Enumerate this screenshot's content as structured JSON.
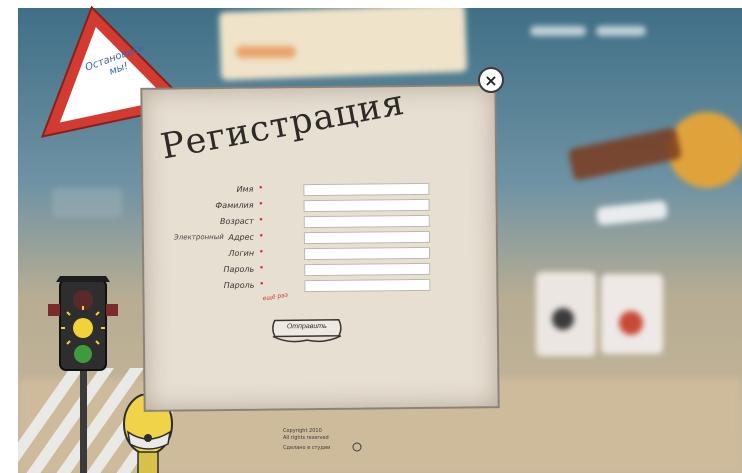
{
  "window": {
    "title": "Регистрация"
  },
  "sign": {
    "text": "Остановись мы!",
    "icon": "warning-triangle-icon"
  },
  "dialog": {
    "title": "Регистрация",
    "close_label": "×",
    "fields": [
      {
        "label": "Имя",
        "required_mark": "•",
        "value": ""
      },
      {
        "label": "Фамилия",
        "required_mark": "•",
        "value": ""
      },
      {
        "label": "Возраст",
        "required_mark": "•",
        "value": ""
      },
      {
        "label": "Адрес",
        "required_mark": "•",
        "value": "",
        "note": "Электронный"
      },
      {
        "label": "Логин",
        "required_mark": "•",
        "value": ""
      },
      {
        "label": "Пароль",
        "required_mark": "•",
        "value": ""
      },
      {
        "label": "Пароль",
        "required_mark": "•",
        "value": ""
      }
    ],
    "password_hint": "ещё раз",
    "submit_label": "Отправить"
  },
  "footer": {
    "copyright": "Copyright 2010",
    "rights": "All rights reserved",
    "developer": "Сделано в студии"
  },
  "colors": {
    "accent": "#c53a2f",
    "panel": "#e6dfd2",
    "sky": "#3f6f86"
  }
}
